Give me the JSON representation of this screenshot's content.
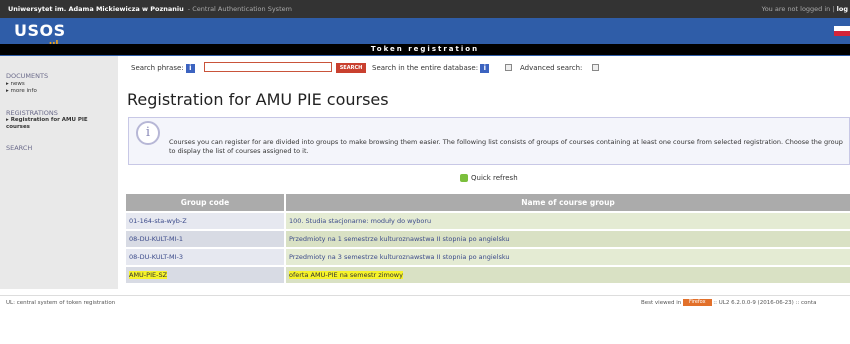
{
  "topbar": {
    "university": "Uniwersytet im. Adama Mickiewicza w Poznaniu",
    "system": "- Central Authentication System",
    "not_logged": "You are not logged in |",
    "login": "log"
  },
  "branding": {
    "logo": "USOS",
    "logo_sub": "ul",
    "page_title": "Token registration"
  },
  "sidebar": {
    "documents": "DOCUMENTS",
    "news": "news",
    "more_info": "more info",
    "registrations": "REGISTRATIONS",
    "registration_link": "Registration for AMU PIE courses",
    "search": "SEARCH"
  },
  "search": {
    "phrase_label": "Search phrase:",
    "button": "SEARCH",
    "entire_db_label": "Search in the entire database:",
    "advanced_label": "Advanced search:"
  },
  "main": {
    "heading": "Registration for AMU PIE courses",
    "info_text": "Courses you can register for are divided into groups to make browsing them easier. The following list consists of groups of courses containing at least one course from selected registration. Choose the group to display the list of courses assigned to it.",
    "refresh": "Quick refresh"
  },
  "table": {
    "headers": [
      "Group code",
      "Name of course group"
    ],
    "rows": [
      {
        "code": "01-164-sta-wyb-Z",
        "name": "100. Studia stacjonarne: moduły do wyboru"
      },
      {
        "code": "08-DU-KULT-MI-1",
        "name": "Przedmioty na 1 semestrze kulturoznawstwa II stopnia po angielsku"
      },
      {
        "code": "08-DU-KULT-MI-3",
        "name": "Przedmioty na 3 semestrze kulturoznawstwa II stopnia po angielsku"
      },
      {
        "code": "AMU-PIE-SZ",
        "name": "oferta AMU-PIE na semestr zimowy"
      }
    ]
  },
  "footer": {
    "left": "UL: central system of token registration",
    "best_viewed": "Best viewed in",
    "browser": "Firefox",
    "version": "UL2 6.2.0.0-9 (2016-06-23)",
    "contact": "conta"
  },
  "colors": {
    "brand_blue": "#2f5da8",
    "accent_orange": "#f3a41c",
    "search_red": "#c9402f",
    "highlight": "#f6f32a"
  }
}
